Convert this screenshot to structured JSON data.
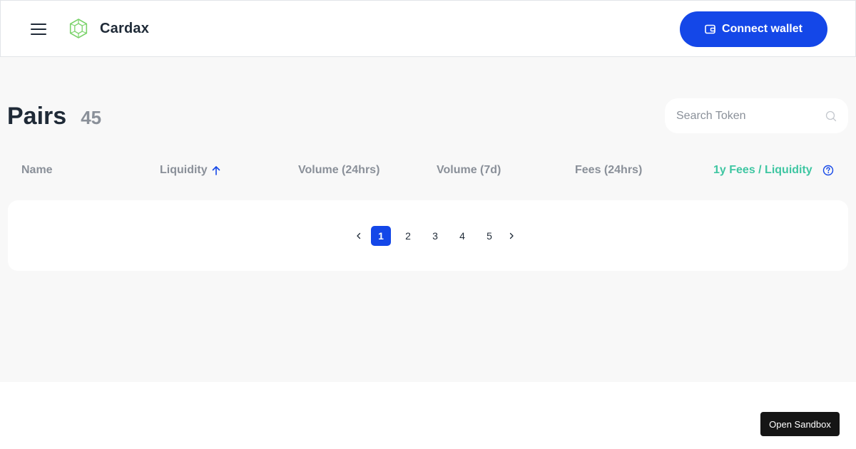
{
  "header": {
    "menu_icon": "hamburger-menu-icon",
    "logo_icon": "hexagon-cube-logo",
    "brand": "Cardax",
    "connect_button": {
      "label": "Connect wallet",
      "icon": "wallet-icon"
    }
  },
  "pairs": {
    "title": "Pairs",
    "count": "45",
    "search": {
      "placeholder": "Search Token",
      "value": "",
      "icon": "search-icon"
    },
    "columns": [
      {
        "label": "Name"
      },
      {
        "label": "Liquidity",
        "sort": "ascending",
        "icon": "arrow-up-icon"
      },
      {
        "label": "Volume (24hrs)"
      },
      {
        "label": "Volume (7d)"
      },
      {
        "label": "Fees (24hrs)"
      },
      {
        "label": "1y Fees / Liquidity",
        "icon": "help-circle-icon"
      }
    ],
    "rows": []
  },
  "pagination": {
    "pages": [
      "1",
      "2",
      "3",
      "4",
      "5"
    ],
    "current": "1",
    "prev_icon": "chevron-left-icon",
    "next_icon": "chevron-right-icon"
  },
  "sandbox_button": {
    "label": "Open Sandbox"
  },
  "colors": {
    "primary": "#1447e8",
    "accent": "#3fc6a2",
    "logo": "#7bd36b",
    "text": "#1f2a37",
    "muted": "#8a9099",
    "background": "#f8f8f8"
  }
}
